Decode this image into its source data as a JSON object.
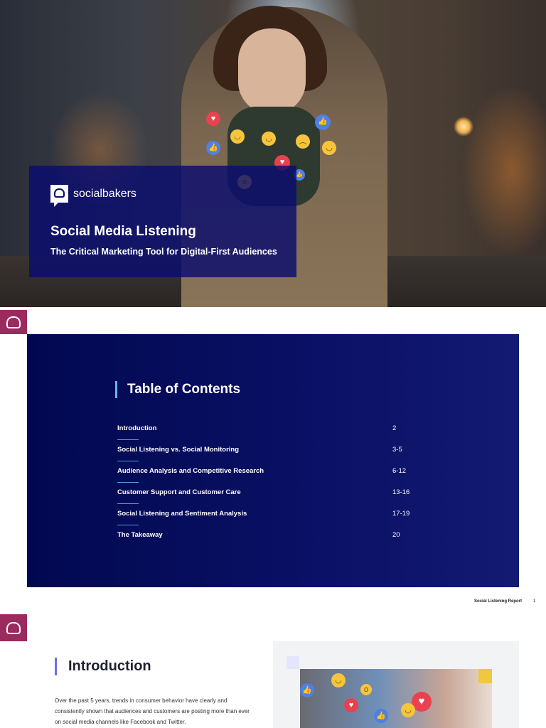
{
  "cover": {
    "brand": "socialbakers",
    "title": "Social Media Listening",
    "subtitle": "The Critical Marketing Tool for Digital-First Audiences"
  },
  "toc": {
    "title": "Table of Contents",
    "items": [
      {
        "label": "Introduction",
        "pages": "2"
      },
      {
        "label": "Social Listening vs. Social Monitoring",
        "pages": "3-5"
      },
      {
        "label": "Audience Analysis and Competitive Research",
        "pages": "6-12"
      },
      {
        "label": "Customer Support and Customer Care",
        "pages": "13-16"
      },
      {
        "label": "Social Listening and Sentiment Analysis",
        "pages": "17-19"
      },
      {
        "label": "The Takeaway",
        "pages": "20"
      }
    ]
  },
  "footer": {
    "report": "Social Listening Report",
    "page": "1"
  },
  "intro": {
    "title": "Introduction",
    "body": "Over the past 5 years, trends in consumer behavior have clearly and consistently shown that audiences and customers are posting more than ever on social media channels like Facebook and Twitter."
  },
  "colors": {
    "brand_tab": "#9b2a5e",
    "toc_bg": "#020850",
    "accent": "#6b6fe8"
  }
}
